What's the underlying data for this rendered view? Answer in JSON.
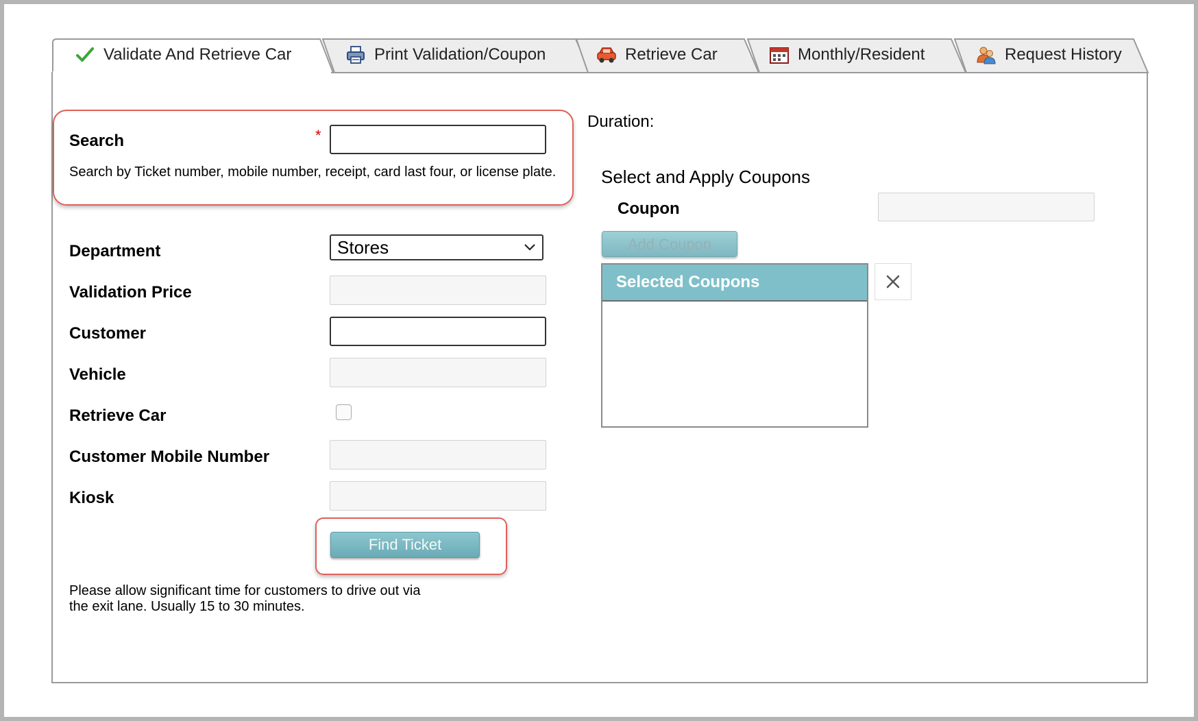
{
  "tabs": [
    {
      "label": "Validate And Retrieve Car",
      "icon": "checkmark-icon",
      "active": true
    },
    {
      "label": "Print Validation/Coupon",
      "icon": "printer-icon",
      "active": false
    },
    {
      "label": "Retrieve Car",
      "icon": "car-icon",
      "active": false
    },
    {
      "label": "Monthly/Resident",
      "icon": "calendar-icon",
      "active": false
    },
    {
      "label": "Request History",
      "icon": "users-icon",
      "active": false
    }
  ],
  "form": {
    "search_label": "Search",
    "required_marker": "*",
    "search_value": "",
    "search_help": "Search by Ticket number, mobile number, receipt, card last four, or license plate.",
    "department_label": "Department",
    "department_value": "Stores",
    "validation_price_label": "Validation Price",
    "customer_label": "Customer",
    "vehicle_label": "Vehicle",
    "retrieve_car_label": "Retrieve Car",
    "retrieve_car_checked": false,
    "mobile_label": "Customer Mobile Number",
    "kiosk_label": "Kiosk",
    "find_button": "Find Ticket",
    "note_line1": "Please allow significant time for customers to drive out via",
    "note_line2": "the exit lane. Usually 15 to 30 minutes."
  },
  "right": {
    "duration_label": "Duration:",
    "coupons_heading": "Select and Apply Coupons",
    "coupon_label": "Coupon",
    "add_coupon_button": "Add Coupon",
    "selected_coupons_header": "Selected Coupons",
    "clear_icon": "close-icon"
  },
  "colors": {
    "accent_teal": "#7fbfc9",
    "highlight_red": "#e0605a",
    "required_red": "#d00000",
    "check_green": "#3aa63a"
  }
}
